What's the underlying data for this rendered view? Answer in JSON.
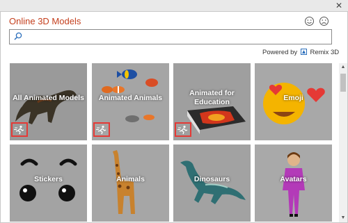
{
  "dialog": {
    "title": "Online 3D Models",
    "close_label": "✕",
    "feedback": {
      "happy": "smile-icon",
      "sad": "frown-icon"
    }
  },
  "search": {
    "value": "",
    "placeholder": ""
  },
  "powered": {
    "prefix": "Powered by",
    "brand": "Remix 3D"
  },
  "colors": {
    "title": "#c43e1c",
    "badge_border": "#e53935",
    "tile_bg": "#8c8c8c"
  },
  "tiles": [
    {
      "label": "All Animated Models",
      "animated": true,
      "icon": "dinosaur-model"
    },
    {
      "label": "Animated Animals",
      "animated": true,
      "icon": "fish-model"
    },
    {
      "label": "Animated for Education",
      "animated": true,
      "icon": "volcano-model"
    },
    {
      "label": "Emoji",
      "animated": false,
      "icon": "emoji-model"
    },
    {
      "label": "Stickers",
      "animated": false,
      "icon": "sticker-eyes-model"
    },
    {
      "label": "Animals",
      "animated": false,
      "icon": "giraffe-model"
    },
    {
      "label": "Dinosaurs",
      "animated": false,
      "icon": "plesiosaur-model"
    },
    {
      "label": "Avatars",
      "animated": false,
      "icon": "avatar-model"
    }
  ],
  "scrollbar": {
    "up": "▲",
    "down": "▼"
  }
}
